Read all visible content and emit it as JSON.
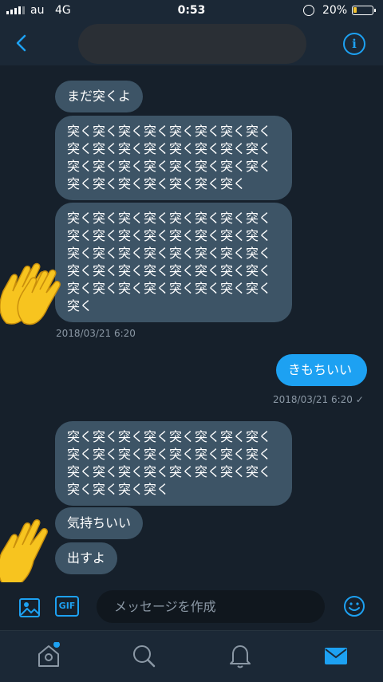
{
  "status_bar": {
    "carrier": "au",
    "network": "4G",
    "time": "0:53",
    "battery_percent": "20%",
    "battery_level": 0.2
  },
  "header": {
    "back_icon": "chevron-left-icon",
    "info_icon": "info-icon"
  },
  "messages": [
    {
      "direction": "in",
      "text": "まだ突くよ"
    },
    {
      "direction": "in",
      "text": "突く突く突く突く突く突く突く突く\n突く突く突く突く突く突く突く突く\n突く突く突く突く突く突く突く突く\n突く突く突く突く突く突く突く"
    },
    {
      "direction": "in",
      "text": "突く突く突く突く突く突く突く突く\n突く突く突く突く突く突く突く突く\n突く突く突く突く突く突く突く突く\n突く突く突く突く突く突く突く突く\n突く突く突く突く突く突く突く突く\n突く"
    },
    {
      "direction": "in",
      "text": "突く突く突く突く突く突く突く突く\n突く突く突く突く突く突く突く突く\n突く突く突く突く突く突く突く突く\n突く突く突く突く"
    },
    {
      "direction": "in",
      "text": "気持ちいい"
    },
    {
      "direction": "in",
      "text": "出すよ"
    },
    {
      "direction": "out",
      "text": "きもちいい"
    }
  ],
  "timestamps": {
    "incoming": "2018/03/21 6:20",
    "outgoing": "2018/03/21 6:20 ✓"
  },
  "composer": {
    "placeholder": "メッセージを作成",
    "gif_label": "GIF"
  },
  "colors": {
    "accent": "#1da1f2",
    "bubble_in": "#3d5466",
    "background": "#16202b",
    "hand": "#f7c41f"
  }
}
